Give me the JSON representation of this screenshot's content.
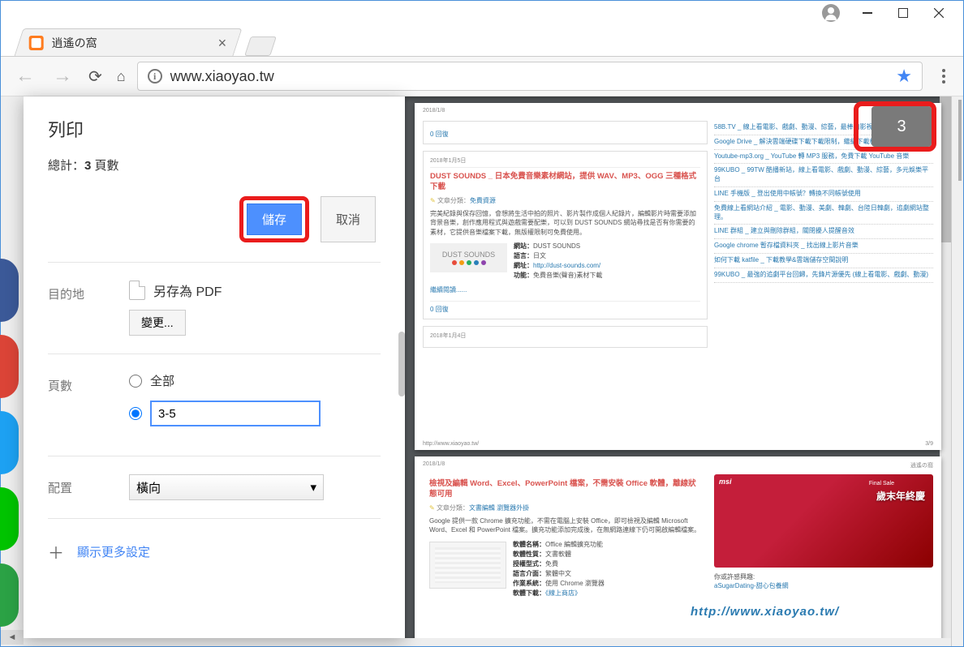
{
  "window": {
    "tab_title": "逍遙の窩",
    "url": "www.xiaoyao.tw"
  },
  "print": {
    "title": "列印",
    "total_prefix": "總計：",
    "total_count": "3",
    "total_suffix": " 頁數",
    "save_btn": "儲存",
    "cancel_btn": "取消",
    "dest_label": "目的地",
    "dest_value": "另存為 PDF",
    "change_btn": "變更...",
    "pages_label": "頁數",
    "pages_all": "全部",
    "pages_range_value": "3-5",
    "layout_label": "配置",
    "layout_value": "橫向",
    "more_settings": "顯示更多設定"
  },
  "preview": {
    "page_counter": "3",
    "header_date": "2018/1/8",
    "header_site": "逍遙の窩",
    "footer_url": "http://www.xiaoyao.tw/",
    "footer_pagenum": "3/9",
    "reply0": "0 回復",
    "card1": {
      "date": "2018年1月5日",
      "title": "DUST SOUNDS _ 日本免費音樂素材網站，提供 WAV、MP3、OGG 三種格式下載",
      "cat_label": "文章分類：",
      "cat_value": "免費資源",
      "text": "完美紀錄與保存回憶，會想將生活中拍的照片、影片製作成個人紀錄片，編輯影片時需要添加背景音樂，創作應用程式與遊戲需要配樂，可以到 DUST SOUNDS 網站尋找是否有你需要的素材，它提供音樂檔案下載，無版權限制可免費使用。",
      "meta_name_label": "網站：",
      "meta_name": "DUST SOUNDS",
      "meta_lang_label": "語言：",
      "meta_lang": "日文",
      "meta_url_label": "網址：",
      "meta_url": "http://dust-sounds.com/",
      "meta_func_label": "功能：",
      "meta_func": "免費音樂(聲音)素材下載",
      "more": "繼續閱讀......",
      "thumb_text": "DUST SOUNDS"
    },
    "card2": {
      "date": "2018年1月4日"
    },
    "sidebar": [
      "58B.TV _ 線上看電影、戲劇、動漫、綜藝，最棒的影視交流社群",
      "Google Drive _ 解決雲端硬碟下載下載限制，繼續下載檢視檔案",
      "Youtube-mp3.org _ YouTube 轉 MP3 服務，免費下載 YouTube 音樂",
      "99KUBO _ 99TW 酷播新站，線上看電影、戲劇、動漫、綜藝，多元娛樂平台",
      "LINE 手機版 _ 登出使用中帳號？轉換不同帳號使用",
      "免費線上看網站介紹 _ 電影、動漫、美劇、韓劇、台陸日韓劇，追劇網站整理。",
      "LINE 群組 _ 建立與刪除群組，關閉擾人提醒音效",
      "Google chrome 暫存檔資料夾 _ 找出線上影片音樂",
      "如何下載 katfile _ 下載教學&雲端儲存空間說明",
      "99KUBO _ 最強的追劇平台回歸，先鋒片源優先 (線上看電影、戲劇、動漫)"
    ],
    "page2card": {
      "title": "檢視及編輯 Word、Excel、PowerPoint 檔案，不需安裝 Office 軟體，離線狀態可用",
      "cat_label": "文章分類：",
      "cat_value": "文書編輯 瀏覽器外掛",
      "text": "Google 提供一款 Chrome 擴充功能，不需在電腦上安裝 Office，即可檢視及編輯 Microsoft Word、Excel 和 PowerPoint 檔案。擴充功能添加完成後，在無網路連線下仍可開啟編輯檔案。",
      "m1_label": "軟體名稱：",
      "m1": "Office 編輯擴充功能",
      "m2_label": "軟體性質：",
      "m2": "文書軟體",
      "m3_label": "授權型式：",
      "m3": "免費",
      "m4_label": "語言介面：",
      "m4": "繁體中文",
      "m5_label": "作業系統：",
      "m5": "使用 Chrome 瀏覽器",
      "m6_label": "軟體下載：",
      "m6": "《線上商店》"
    },
    "ad": {
      "brand": "msi",
      "line1": "歲末年終慶",
      "line2": "Final Sale"
    },
    "sidebox": {
      "t1": "你或許感興趣:",
      "t2": "aSugarDating-甜心包養網"
    },
    "watermark_url": "http://www.xiaoyao.tw/"
  }
}
